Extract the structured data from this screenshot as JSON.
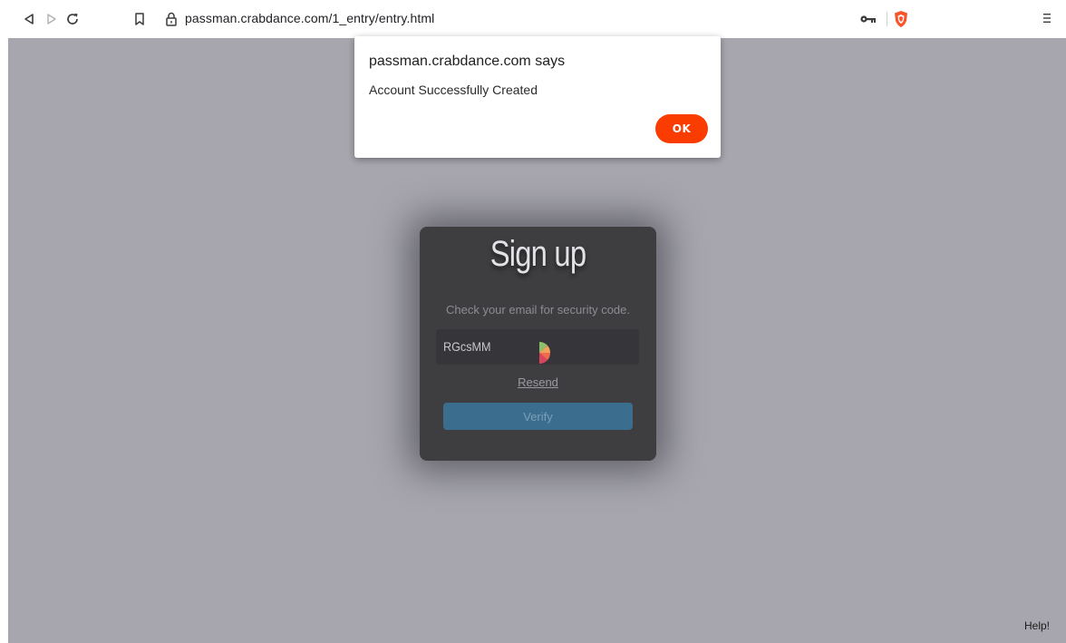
{
  "browser": {
    "url": "passman.crabdance.com/1_entry/entry.html",
    "icons": {
      "back": "back-triangle-icon",
      "forward": "forward-triangle-icon",
      "reload": "reload-icon",
      "bookmark": "bookmark-icon",
      "lock": "lock-icon",
      "key": "key-icon",
      "brave": "brave-shield-icon",
      "menu": "hamburger-menu-icon"
    },
    "colors": {
      "brave": "#fb542b"
    }
  },
  "dialog": {
    "title": "passman.crabdance.com says",
    "message": "Account Successfully Created",
    "ok_label": "OK",
    "ok_color": "#fb3c00"
  },
  "signup": {
    "title": "Sign up",
    "hint": "Check your email for security code.",
    "code_value": "RGcsMM",
    "resend_label": "Resend",
    "verify_label": "Verify",
    "verify_color": "#3b6d8e"
  },
  "footer": {
    "help_label": "Help!"
  }
}
